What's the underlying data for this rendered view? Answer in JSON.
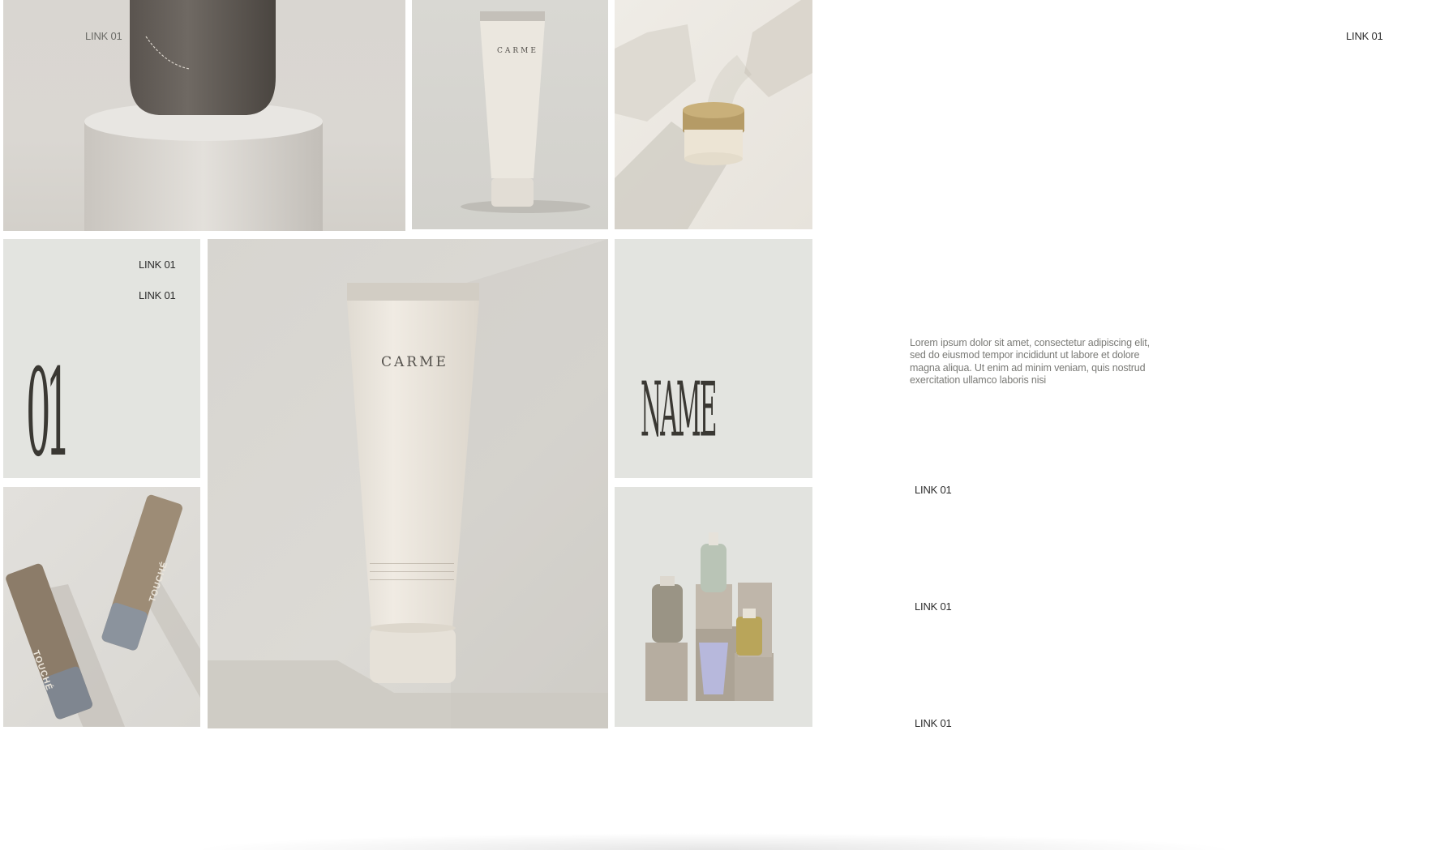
{
  "colors": {
    "page_bg": "#ffffff",
    "tile_bg": "#e4e5e1",
    "tile_bg_warm": "#dcd8d1",
    "link_color": "#2b2b2b",
    "paragraph_color": "#7a7a76"
  },
  "links": {
    "top_left": "LINK 01",
    "top_right": "LINK 01",
    "tile_a": "LINK 01",
    "tile_b": "LINK 01",
    "side_1": "LINK 01",
    "side_2": "LINK 01",
    "side_3": "LINK 01"
  },
  "tiles": {
    "number": "01",
    "name": "NAME"
  },
  "products": {
    "tube_brand": "CARME",
    "small_tube_brand": "CARME",
    "bottle_left": "TOUCHÉ",
    "bottle_right": "TOUCHÉ"
  },
  "paragraph": "Lorem ipsum dolor sit amet, consectetur adipiscing elit, sed do eiusmod tempor incididunt ut labore et dolore magna aliqua. Ut enim ad minim veniam, quis nostrud exercitation ullamco laboris nisi"
}
